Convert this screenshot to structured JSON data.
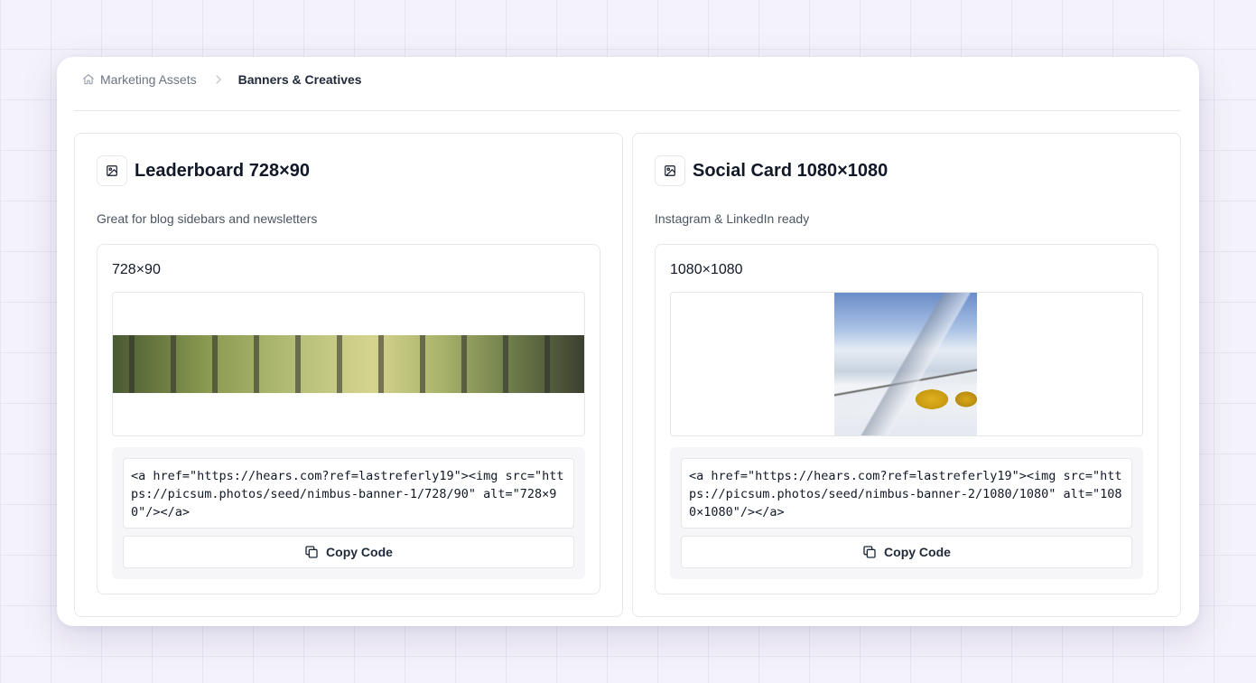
{
  "breadcrumb": {
    "root_icon": "home-icon",
    "root": "Marketing Assets",
    "separator_icon": "chevron-right-icon",
    "current": "Banners & Creatives"
  },
  "cards": [
    {
      "icon": "image-icon",
      "title": "Leaderboard 728×90",
      "description": "Great for blog sidebars and newsletters",
      "size_label": "728×90",
      "code": "<a href=\"https://hears.com?ref=lastreferly19\"><img src=\"https://picsum.photos/seed/nimbus-banner-1/728/90\" alt=\"728×90\"/></a>",
      "copy_label": "Copy Code",
      "copy_icon": "copy-icon"
    },
    {
      "icon": "image-icon",
      "title": "Social Card 1080×1080",
      "description": "Instagram & LinkedIn ready",
      "size_label": "1080×1080",
      "code": "<a href=\"https://hears.com?ref=lastreferly19\"><img src=\"https://picsum.photos/seed/nimbus-banner-2/1080/1080\" alt=\"1080×1080\"/></a>",
      "copy_label": "Copy Code",
      "copy_icon": "copy-icon"
    }
  ]
}
